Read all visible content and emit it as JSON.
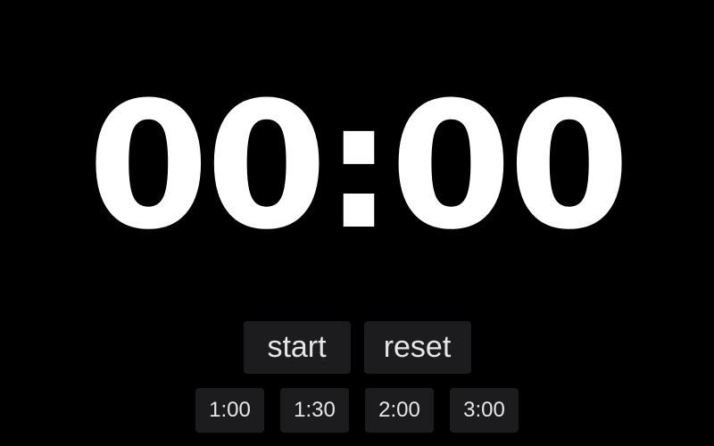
{
  "timer": {
    "display": "00:00"
  },
  "controls": {
    "start_label": "start",
    "reset_label": "reset"
  },
  "presets": {
    "items": [
      {
        "label": "1:00"
      },
      {
        "label": "1:30"
      },
      {
        "label": "2:00"
      },
      {
        "label": "3:00"
      }
    ]
  },
  "colors": {
    "background": "#000000",
    "timer_text": "#ffffff",
    "button_bg": "#1c1c1e",
    "button_text": "#e6e6e6"
  }
}
